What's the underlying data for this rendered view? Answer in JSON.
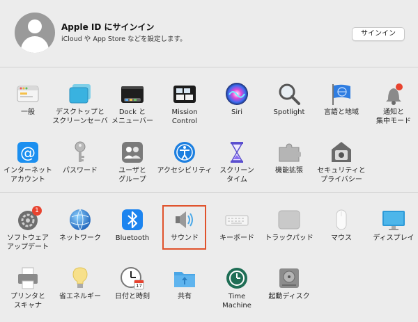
{
  "header": {
    "title": "Apple ID にサインイン",
    "subtitle": "iCloud や App Store などを設定します。",
    "signin_button": "サインイン"
  },
  "row1": [
    {
      "label": "一般",
      "icon": "general-icon"
    },
    {
      "label": "デスクトップと\nスクリーンセーバ",
      "icon": "desktop-icon"
    },
    {
      "label": "Dock と\nメニューバー",
      "icon": "dock-icon"
    },
    {
      "label": "Mission\nControl",
      "icon": "mission-control-icon"
    },
    {
      "label": "Siri",
      "icon": "siri-icon"
    },
    {
      "label": "Spotlight",
      "icon": "spotlight-icon"
    },
    {
      "label": "言語と地域",
      "icon": "language-icon"
    },
    {
      "label": "通知と\n集中モード",
      "icon": "notifications-icon"
    }
  ],
  "row2": [
    {
      "label": "インターネット\nアカウント",
      "icon": "internet-accounts-icon"
    },
    {
      "label": "パスワード",
      "icon": "passwords-icon"
    },
    {
      "label": "ユーザと\nグループ",
      "icon": "users-icon"
    },
    {
      "label": "アクセシビリティ",
      "icon": "accessibility-icon"
    },
    {
      "label": "スクリーン\nタイム",
      "icon": "screen-time-icon"
    },
    {
      "label": "機能拡張",
      "icon": "extensions-icon"
    },
    {
      "label": "セキュリティと\nプライバシー",
      "icon": "security-icon"
    }
  ],
  "row3": [
    {
      "label": "ソフトウェア\nアップデート",
      "icon": "software-update-icon",
      "badge": "1"
    },
    {
      "label": "ネットワーク",
      "icon": "network-icon"
    },
    {
      "label": "Bluetooth",
      "icon": "bluetooth-icon"
    },
    {
      "label": "サウンド",
      "icon": "sound-icon"
    },
    {
      "label": "キーボード",
      "icon": "keyboard-icon"
    },
    {
      "label": "トラックパッド",
      "icon": "trackpad-icon"
    },
    {
      "label": "マウス",
      "icon": "mouse-icon"
    },
    {
      "label": "ディスプレイ",
      "icon": "display-icon"
    }
  ],
  "row4": [
    {
      "label": "プリンタと\nスキャナ",
      "icon": "printer-icon"
    },
    {
      "label": "省エネルギー",
      "icon": "energy-icon"
    },
    {
      "label": "日付と時刻",
      "icon": "clock-icon",
      "date": "17"
    },
    {
      "label": "共有",
      "icon": "sharing-icon"
    },
    {
      "label": "Time\nMachine",
      "icon": "time-machine-icon"
    },
    {
      "label": "起動ディスク",
      "icon": "startup-disk-icon"
    }
  ]
}
